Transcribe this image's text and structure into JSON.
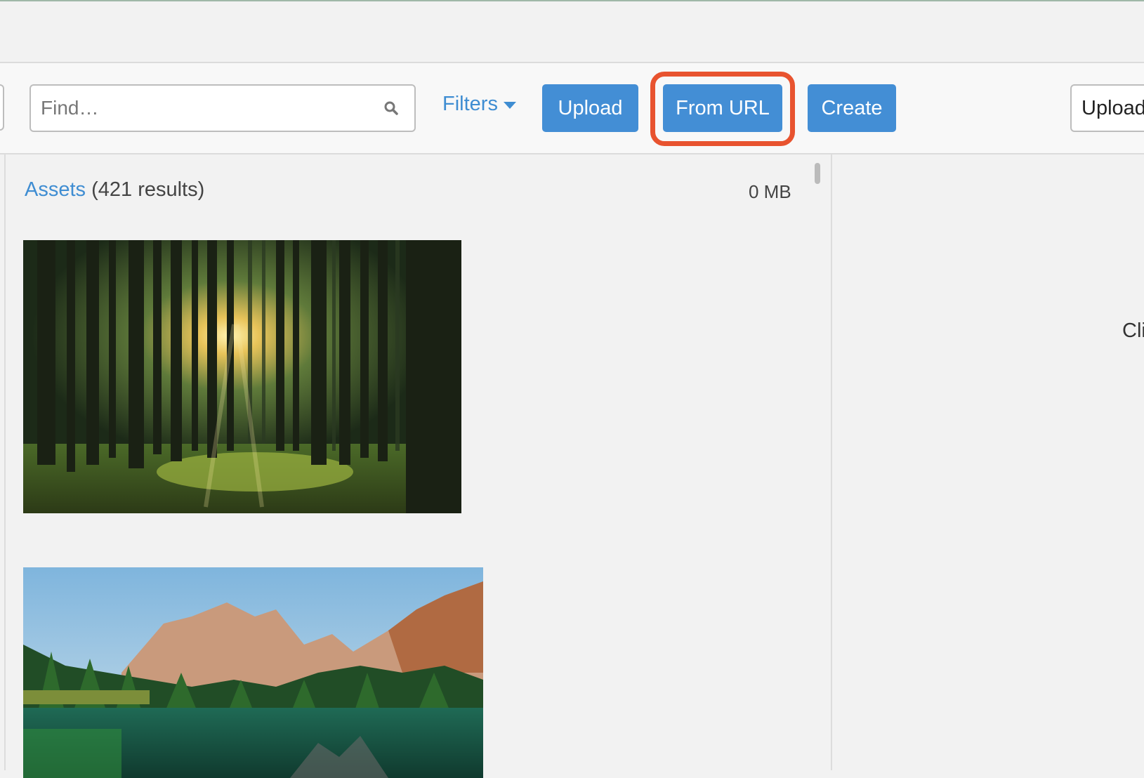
{
  "toolbar": {
    "search": {
      "placeholder": "Find…",
      "value": ""
    },
    "filters_label": "Filters",
    "upload_label": "Upload",
    "from_url_label": "From URL",
    "create_label": "Create",
    "right_button_label": "Upload"
  },
  "assets": {
    "link_label": "Assets",
    "results_text": "(421 results)",
    "size_text": "0 MB"
  },
  "right_panel": {
    "text": "Cli"
  },
  "colors": {
    "accent": "#438ed5",
    "link": "#3f8dd2",
    "highlight": "#e8532f"
  }
}
